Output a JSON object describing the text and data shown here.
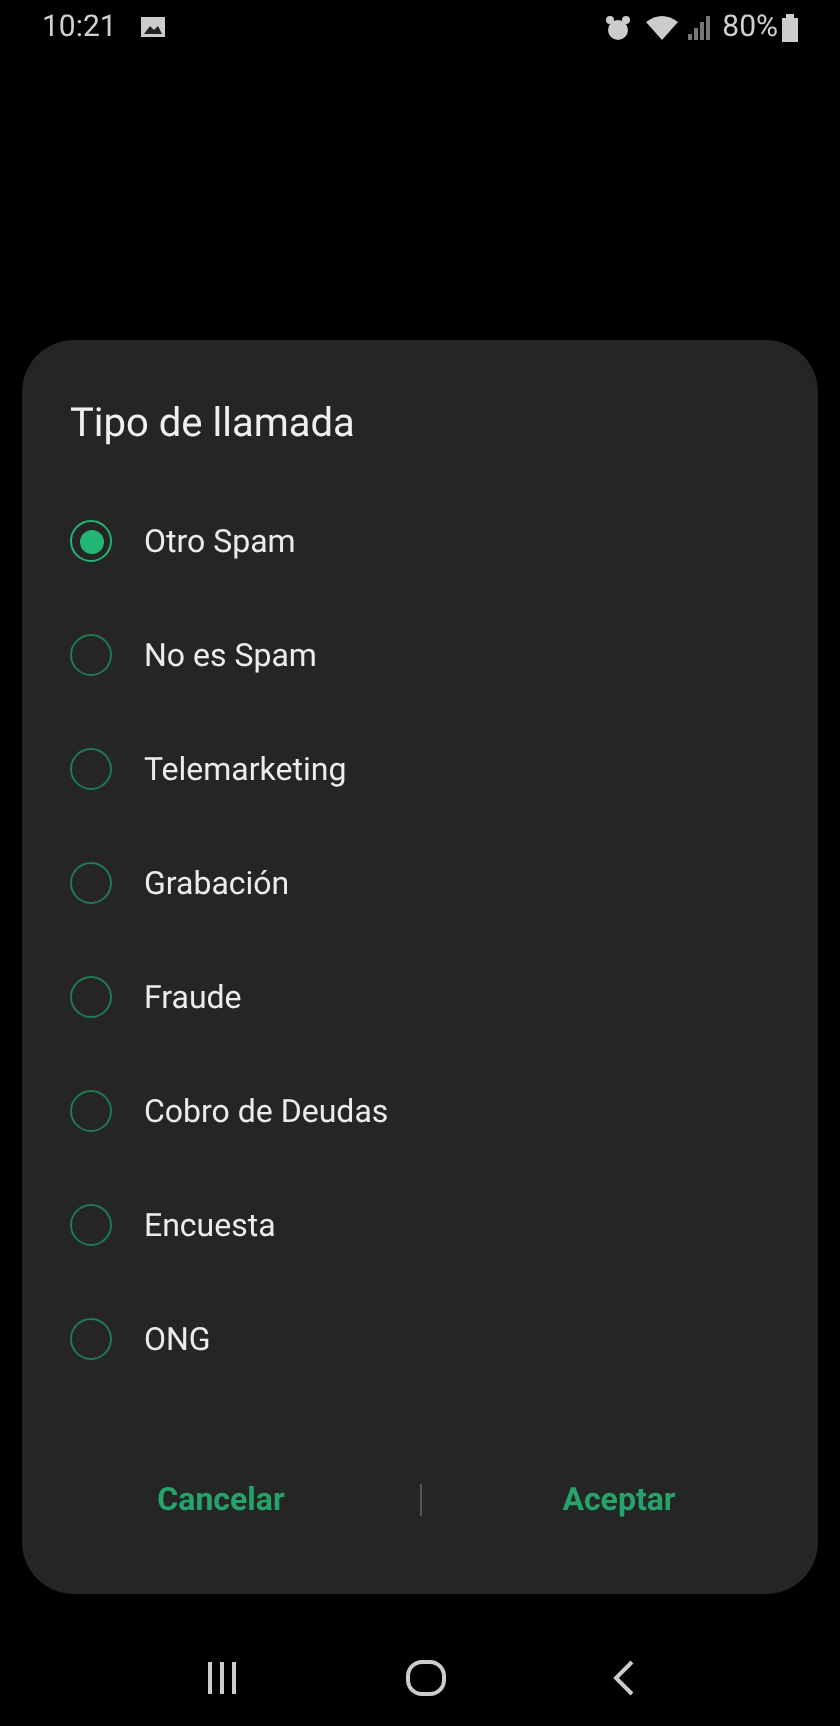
{
  "status_bar": {
    "time": "10:21",
    "battery": "80%"
  },
  "dialog": {
    "title": "Tipo de llamada",
    "options": [
      {
        "label": "Otro Spam",
        "selected": true
      },
      {
        "label": "No es Spam",
        "selected": false
      },
      {
        "label": "Telemarketing",
        "selected": false
      },
      {
        "label": "Grabación",
        "selected": false
      },
      {
        "label": "Fraude",
        "selected": false
      },
      {
        "label": "Cobro de Deudas",
        "selected": false
      },
      {
        "label": "Encuesta",
        "selected": false
      },
      {
        "label": "ONG",
        "selected": false
      }
    ],
    "buttons": [
      "Cancelar",
      "Aceptar"
    ]
  }
}
